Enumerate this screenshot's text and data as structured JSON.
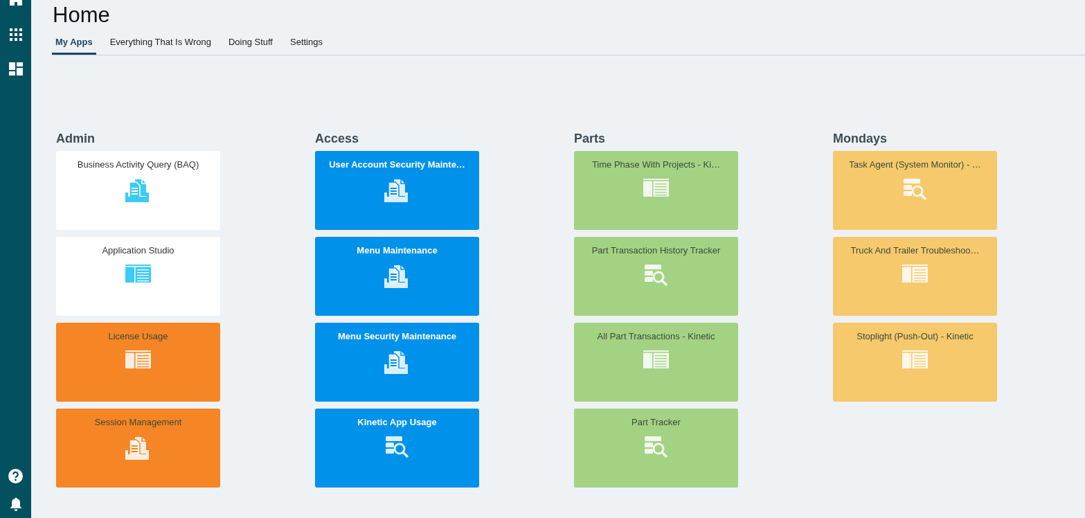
{
  "page": {
    "title": "Home"
  },
  "tabs": [
    {
      "label": "My Apps",
      "selected": true
    },
    {
      "label": "Everything That Is Wrong",
      "selected": false
    },
    {
      "label": "Doing Stuff",
      "selected": false
    },
    {
      "label": "Settings",
      "selected": false
    }
  ],
  "groups": [
    {
      "title": "Admin",
      "tiles": [
        {
          "label": "Business Activity Query (BAQ)",
          "color": "#ffffff",
          "kind": "documents"
        },
        {
          "label": "Application Studio",
          "color": "#ffffff",
          "kind": "layout"
        },
        {
          "label": "License Usage",
          "color": "#f58525",
          "kind": "layout"
        },
        {
          "label": "Session Management",
          "color": "#f58525",
          "kind": "documents"
        }
      ]
    },
    {
      "title": "Access",
      "tiles": [
        {
          "label": "User Account Security Mainte…",
          "color": "#0091ea",
          "kind": "documents"
        },
        {
          "label": "Menu Maintenance",
          "color": "#0091ea",
          "kind": "documents"
        },
        {
          "label": "Menu Security Maintenance",
          "color": "#0091ea",
          "kind": "documents"
        },
        {
          "label": "Kinetic App Usage",
          "color": "#0091ea",
          "kind": "search-list"
        }
      ]
    },
    {
      "title": "Parts",
      "tiles": [
        {
          "label": "Time Phase With Projects - Ki…",
          "color": "#a3d283",
          "kind": "layout"
        },
        {
          "label": "Part Transaction History Tracker",
          "color": "#a3d283",
          "kind": "search-list"
        },
        {
          "label": "All Part Transactions - Kinetic",
          "color": "#a3d283",
          "kind": "layout"
        },
        {
          "label": "Part Tracker",
          "color": "#a3d283",
          "kind": "search-list"
        }
      ]
    },
    {
      "title": "Mondays",
      "tiles": [
        {
          "label": "Task Agent (System Monitor) - …",
          "color": "#f5c96c",
          "kind": "search-list"
        },
        {
          "label": "Truck And Trailer Troubleshoo…",
          "color": "#f5c96c",
          "kind": "layout"
        },
        {
          "label": "Stoplight (Push-Out) - Kinetic",
          "color": "#f5c96c",
          "kind": "layout"
        }
      ]
    }
  ]
}
